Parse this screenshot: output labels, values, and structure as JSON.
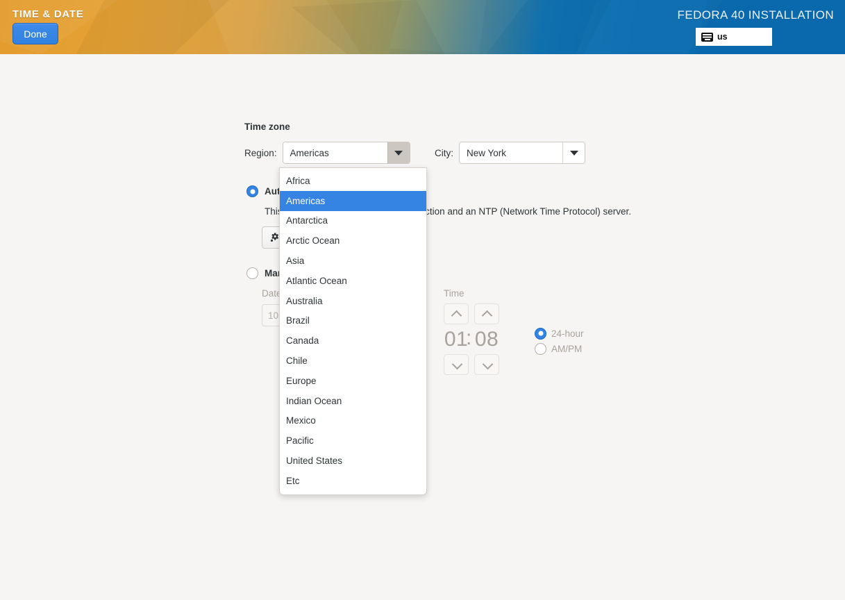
{
  "header": {
    "title": "TIME & DATE",
    "done_label": "Done",
    "installation_title": "FEDORA 40 INSTALLATION",
    "keyboard_layout": "us",
    "keyboard_icon": "keyboard-icon",
    "accent_blue": "#3584e4",
    "gradient_orange": "#e39b2c",
    "gradient_blue": "#0a6cb0"
  },
  "timezone": {
    "section_title": "Time zone",
    "region_label": "Region:",
    "region_value": "Americas",
    "city_label": "City:",
    "city_value": "New York",
    "caret_icon": "chevron-down-icon"
  },
  "region_dropdown": {
    "open": true,
    "selected": "Americas",
    "options": [
      "Africa",
      "Americas",
      "Antarctica",
      "Arctic Ocean",
      "Asia",
      "Atlantic Ocean",
      "Australia",
      "Brazil",
      "Canada",
      "Chile",
      "Europe",
      "Indian Ocean",
      "Mexico",
      "Pacific",
      "United States",
      "Etc"
    ]
  },
  "automatic": {
    "label": "Automatic date & time",
    "description": "This requires a working network connection and an NTP (Network Time Protocol) server.",
    "description_visible_tail": "TP (Network Time Protocol) server.",
    "description_visible_head": "This",
    "selected": true,
    "settings_icon": "gear-icon"
  },
  "manual": {
    "label": "Manual date & time",
    "selected": false,
    "date_label": "Date",
    "date_value": "10",
    "time_label": "Time",
    "hour": "01",
    "separator": ":",
    "minute": "08",
    "up_icon": "chevron-up-icon",
    "down_icon": "chevron-down-icon",
    "formats": [
      {
        "label": "24-hour",
        "selected": true
      },
      {
        "label": "AM/PM",
        "selected": false
      }
    ]
  }
}
